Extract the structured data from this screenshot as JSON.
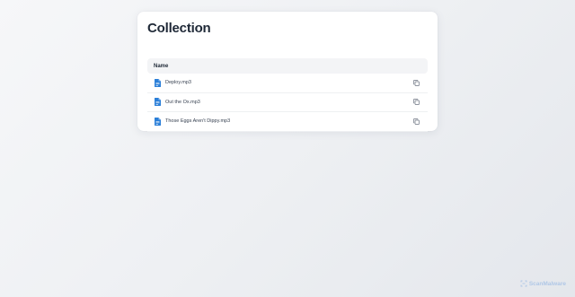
{
  "page": {
    "title": "Collection"
  },
  "table": {
    "header_name": "Name",
    "files": [
      {
        "name": "Deploy.mp3",
        "icon": "file-icon"
      },
      {
        "name": "Out the Ox.mp3",
        "icon": "file-icon"
      },
      {
        "name": "Those Eggs Aren't Dippy.mp3",
        "icon": "file-icon"
      }
    ],
    "row_action_icon": "copy-icon"
  },
  "watermark": {
    "label": "ScanMalware"
  },
  "colors": {
    "accent": "#2b7fd8",
    "title": "#1f2937",
    "watermark": "#aac4e6"
  }
}
